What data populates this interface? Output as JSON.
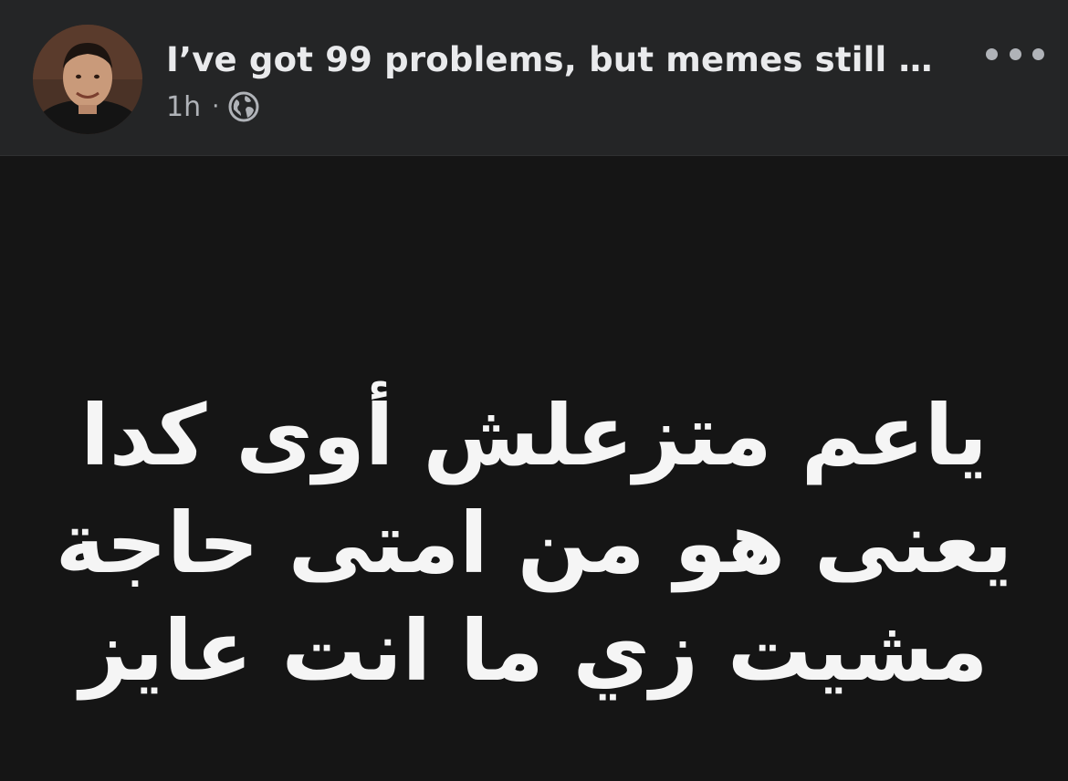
{
  "post": {
    "title": "I’ve got 99 problems, but memes still …",
    "timestamp": "1h",
    "separator": "·",
    "audience_icon": "globe-icon",
    "more_icon": "more-options-icon"
  },
  "meme": {
    "lines": [
      "ياعم متزعلش أوى كدا",
      "يعنى هو من امتى حاجة",
      "مشيت زي ما انت عايز"
    ]
  },
  "colors": {
    "header_bg": "#242526",
    "body_bg": "#151515",
    "title_text": "#e9eaec",
    "meta_text": "#b0b3b8",
    "meme_text": "#f5f5f5"
  }
}
